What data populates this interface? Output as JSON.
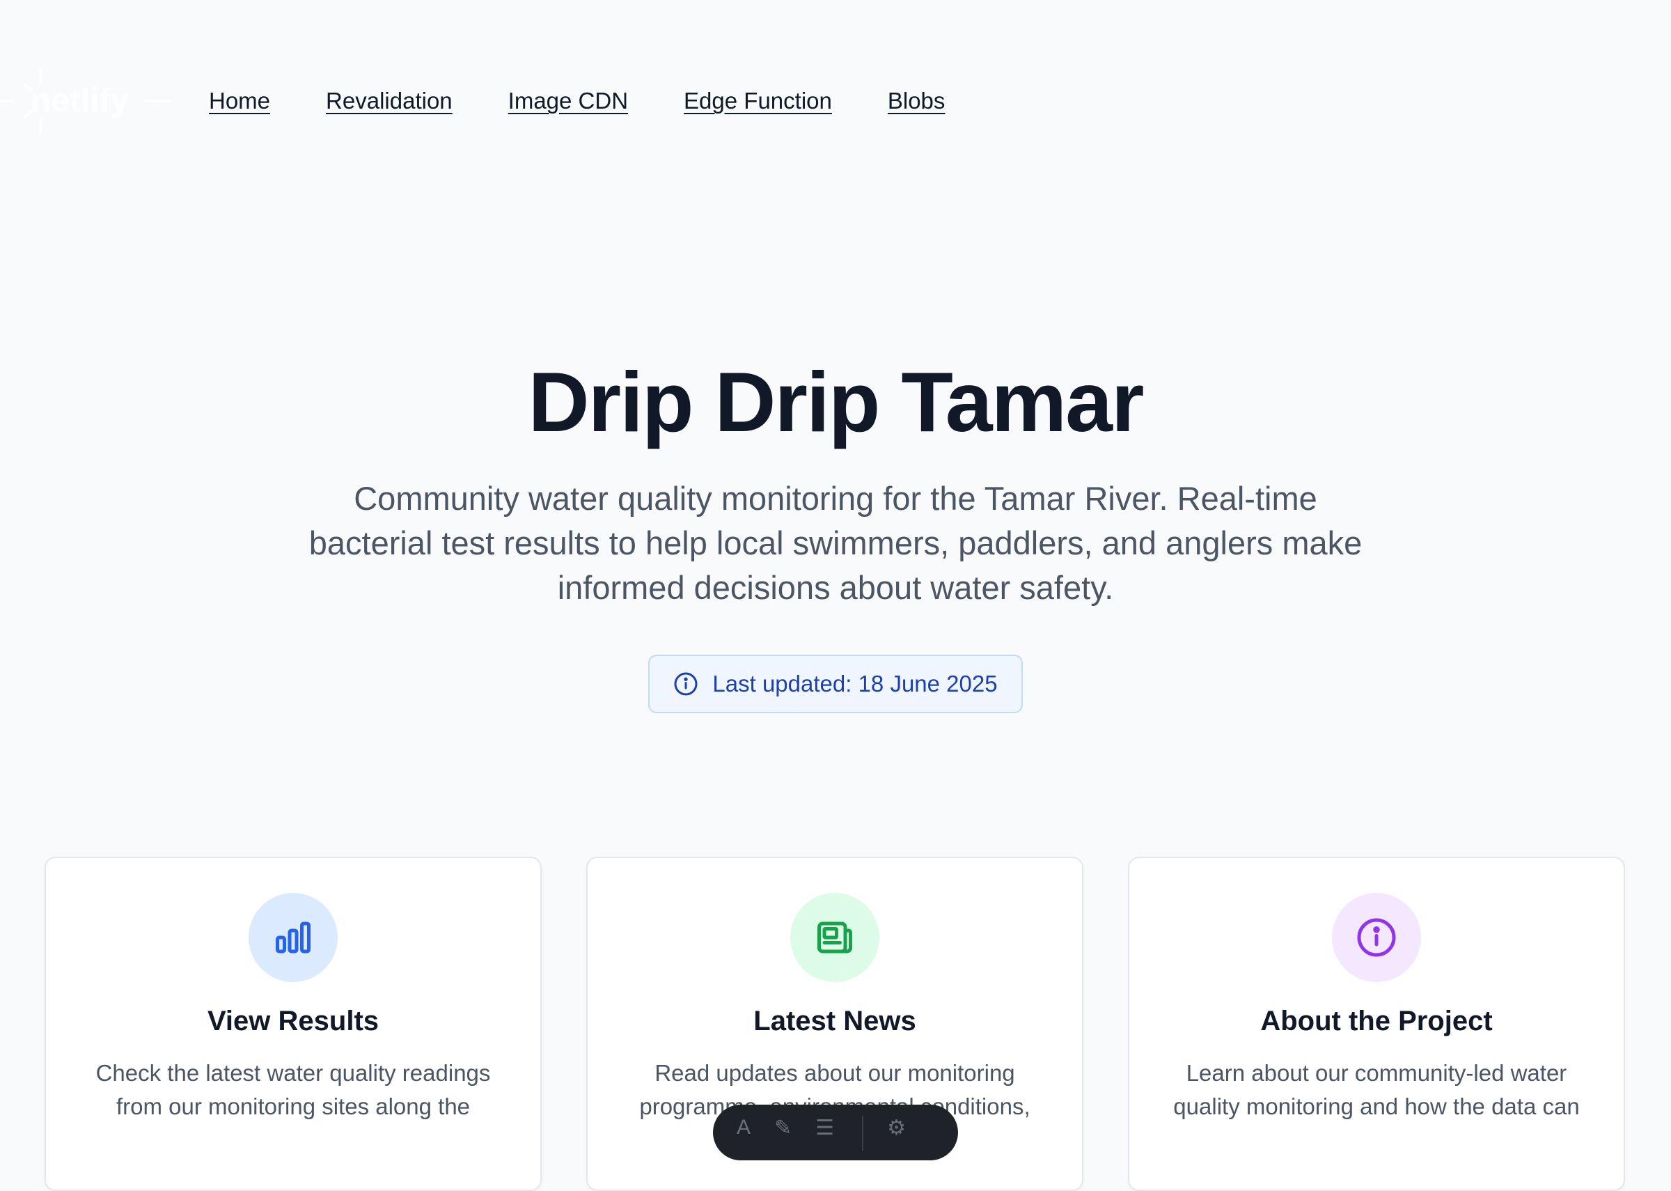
{
  "header": {
    "logo_text": "netlify",
    "nav": [
      {
        "label": "Home"
      },
      {
        "label": "Revalidation"
      },
      {
        "label": "Image CDN"
      },
      {
        "label": "Edge Function"
      },
      {
        "label": "Blobs"
      }
    ]
  },
  "hero": {
    "title": "Drip Drip Tamar",
    "subtitle": "Community water quality monitoring for the Tamar River. Real-time bacterial test results to help local swimmers, paddlers, and anglers make informed decisions about water safety.",
    "updated_label": "Last updated: 18 June 2025"
  },
  "cards": [
    {
      "icon": "bar-chart-icon",
      "title": "View Results",
      "description": "Check the latest water quality readings from our monitoring sites along the",
      "accent": "#2563eb",
      "icon_bg": "#dbeafe"
    },
    {
      "icon": "newspaper-icon",
      "title": "Latest News",
      "description": "Read updates about our monitoring programme, environmental conditions,",
      "accent": "#16a34a",
      "icon_bg": "#dcfce7"
    },
    {
      "icon": "info-icon",
      "title": "About the Project",
      "description": "Learn about our community-led water quality monitoring and how the data can",
      "accent": "#9333ea",
      "icon_bg": "#f3e8ff"
    }
  ],
  "colors": {
    "background": "#f8fafc",
    "badge_bg": "#eff6ff",
    "badge_border": "#bfdbfe",
    "badge_text": "#1e40af"
  }
}
